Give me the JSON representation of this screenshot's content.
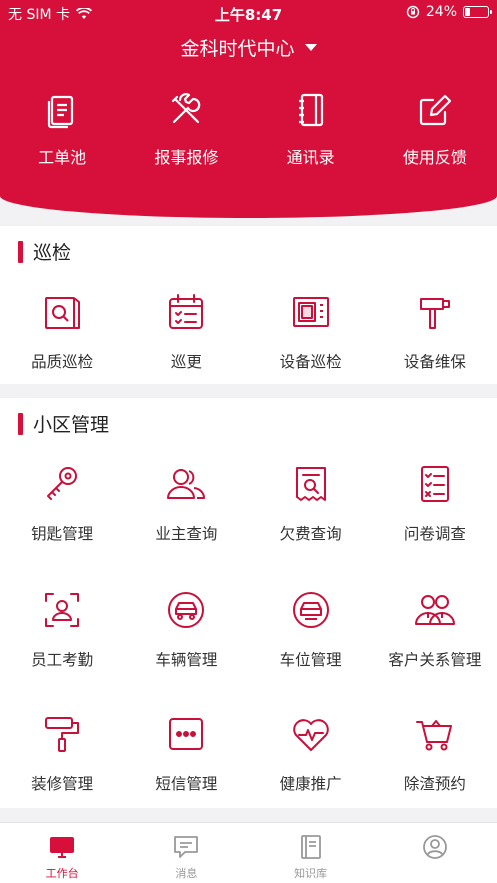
{
  "status_bar": {
    "carrier": "无 SIM 卡",
    "time": "上午8:47",
    "battery": "24%",
    "battery_level": 0.24
  },
  "header": {
    "location": "金科时代中心",
    "quick_actions": [
      {
        "label": "工单池",
        "icon": "document-list-icon"
      },
      {
        "label": "报事报修",
        "icon": "tools-icon"
      },
      {
        "label": "通讯录",
        "icon": "notebook-icon"
      },
      {
        "label": "使用反馈",
        "icon": "edit-icon"
      }
    ]
  },
  "inspection": {
    "title": "巡检",
    "items": [
      {
        "label": "品质巡检",
        "icon": "quality-inspection-icon"
      },
      {
        "label": "巡更",
        "icon": "calendar-icon"
      },
      {
        "label": "设备巡检",
        "icon": "device-panel-icon"
      },
      {
        "label": "设备维保",
        "icon": "hammer-icon"
      }
    ]
  },
  "community": {
    "title": "小区管理",
    "rows": [
      [
        {
          "label": "钥匙管理",
          "icon": "key-icon"
        },
        {
          "label": "业主查询",
          "icon": "owners-icon"
        },
        {
          "label": "欠费查询",
          "icon": "bill-search-icon"
        },
        {
          "label": "问卷调查",
          "icon": "checklist-icon"
        }
      ],
      [
        {
          "label": "员工考勤",
          "icon": "face-scan-icon"
        },
        {
          "label": "车辆管理",
          "icon": "car-icon"
        },
        {
          "label": "车位管理",
          "icon": "parking-icon"
        },
        {
          "label": "客户关系管理",
          "icon": "customer-relations-icon"
        }
      ],
      [
        {
          "label": "装修管理",
          "icon": "paint-roller-icon"
        },
        {
          "label": "短信管理",
          "icon": "sms-icon"
        },
        {
          "label": "健康推广",
          "icon": "heart-pulse-icon"
        },
        {
          "label": "除渣预约",
          "icon": "cart-icon"
        }
      ]
    ]
  },
  "tabbar": {
    "tabs": [
      {
        "label": "工作台",
        "icon": "monitor-icon",
        "active": true
      },
      {
        "label": "消息",
        "icon": "message-icon",
        "active": false
      },
      {
        "label": "知识库",
        "icon": "book-icon",
        "active": false
      },
      {
        "label": "",
        "icon": "profile-icon",
        "active": false
      }
    ]
  },
  "colors": {
    "accent": "#d6103a",
    "background": "#f2f2f4"
  }
}
